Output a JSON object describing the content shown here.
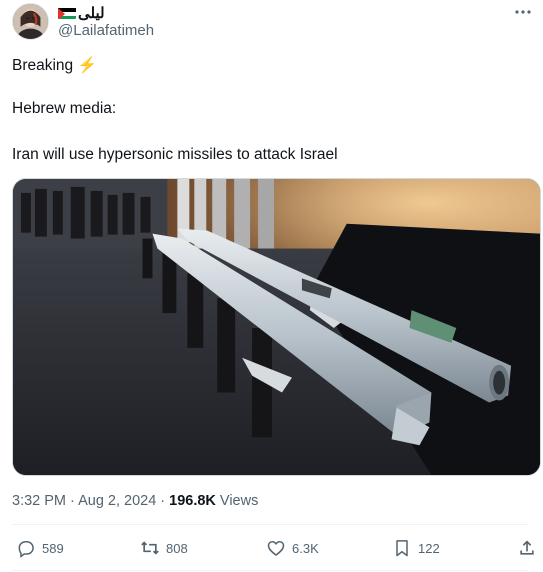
{
  "author": {
    "display_name": "ليلى",
    "handle": "@Lailafatimeh",
    "flag_icon": "palestine-flag-icon"
  },
  "tweet": {
    "line1": "Breaking",
    "line1_emoji": "⚡",
    "line2": "Hebrew media:",
    "line3": "Iran will use hypersonic missiles to attack Israel"
  },
  "meta": {
    "timestamp": "3:32 PM · Aug 2, 2024",
    "separator": "·",
    "views_count": "196.8K",
    "views_label": "Views"
  },
  "actions": {
    "replies": "589",
    "reposts": "808",
    "likes": "6.3K",
    "bookmarks": "122"
  },
  "colors": {
    "text": "#0f1419",
    "secondary": "#536471",
    "bolt": "#f4b400",
    "divider": "#eff3f4"
  }
}
